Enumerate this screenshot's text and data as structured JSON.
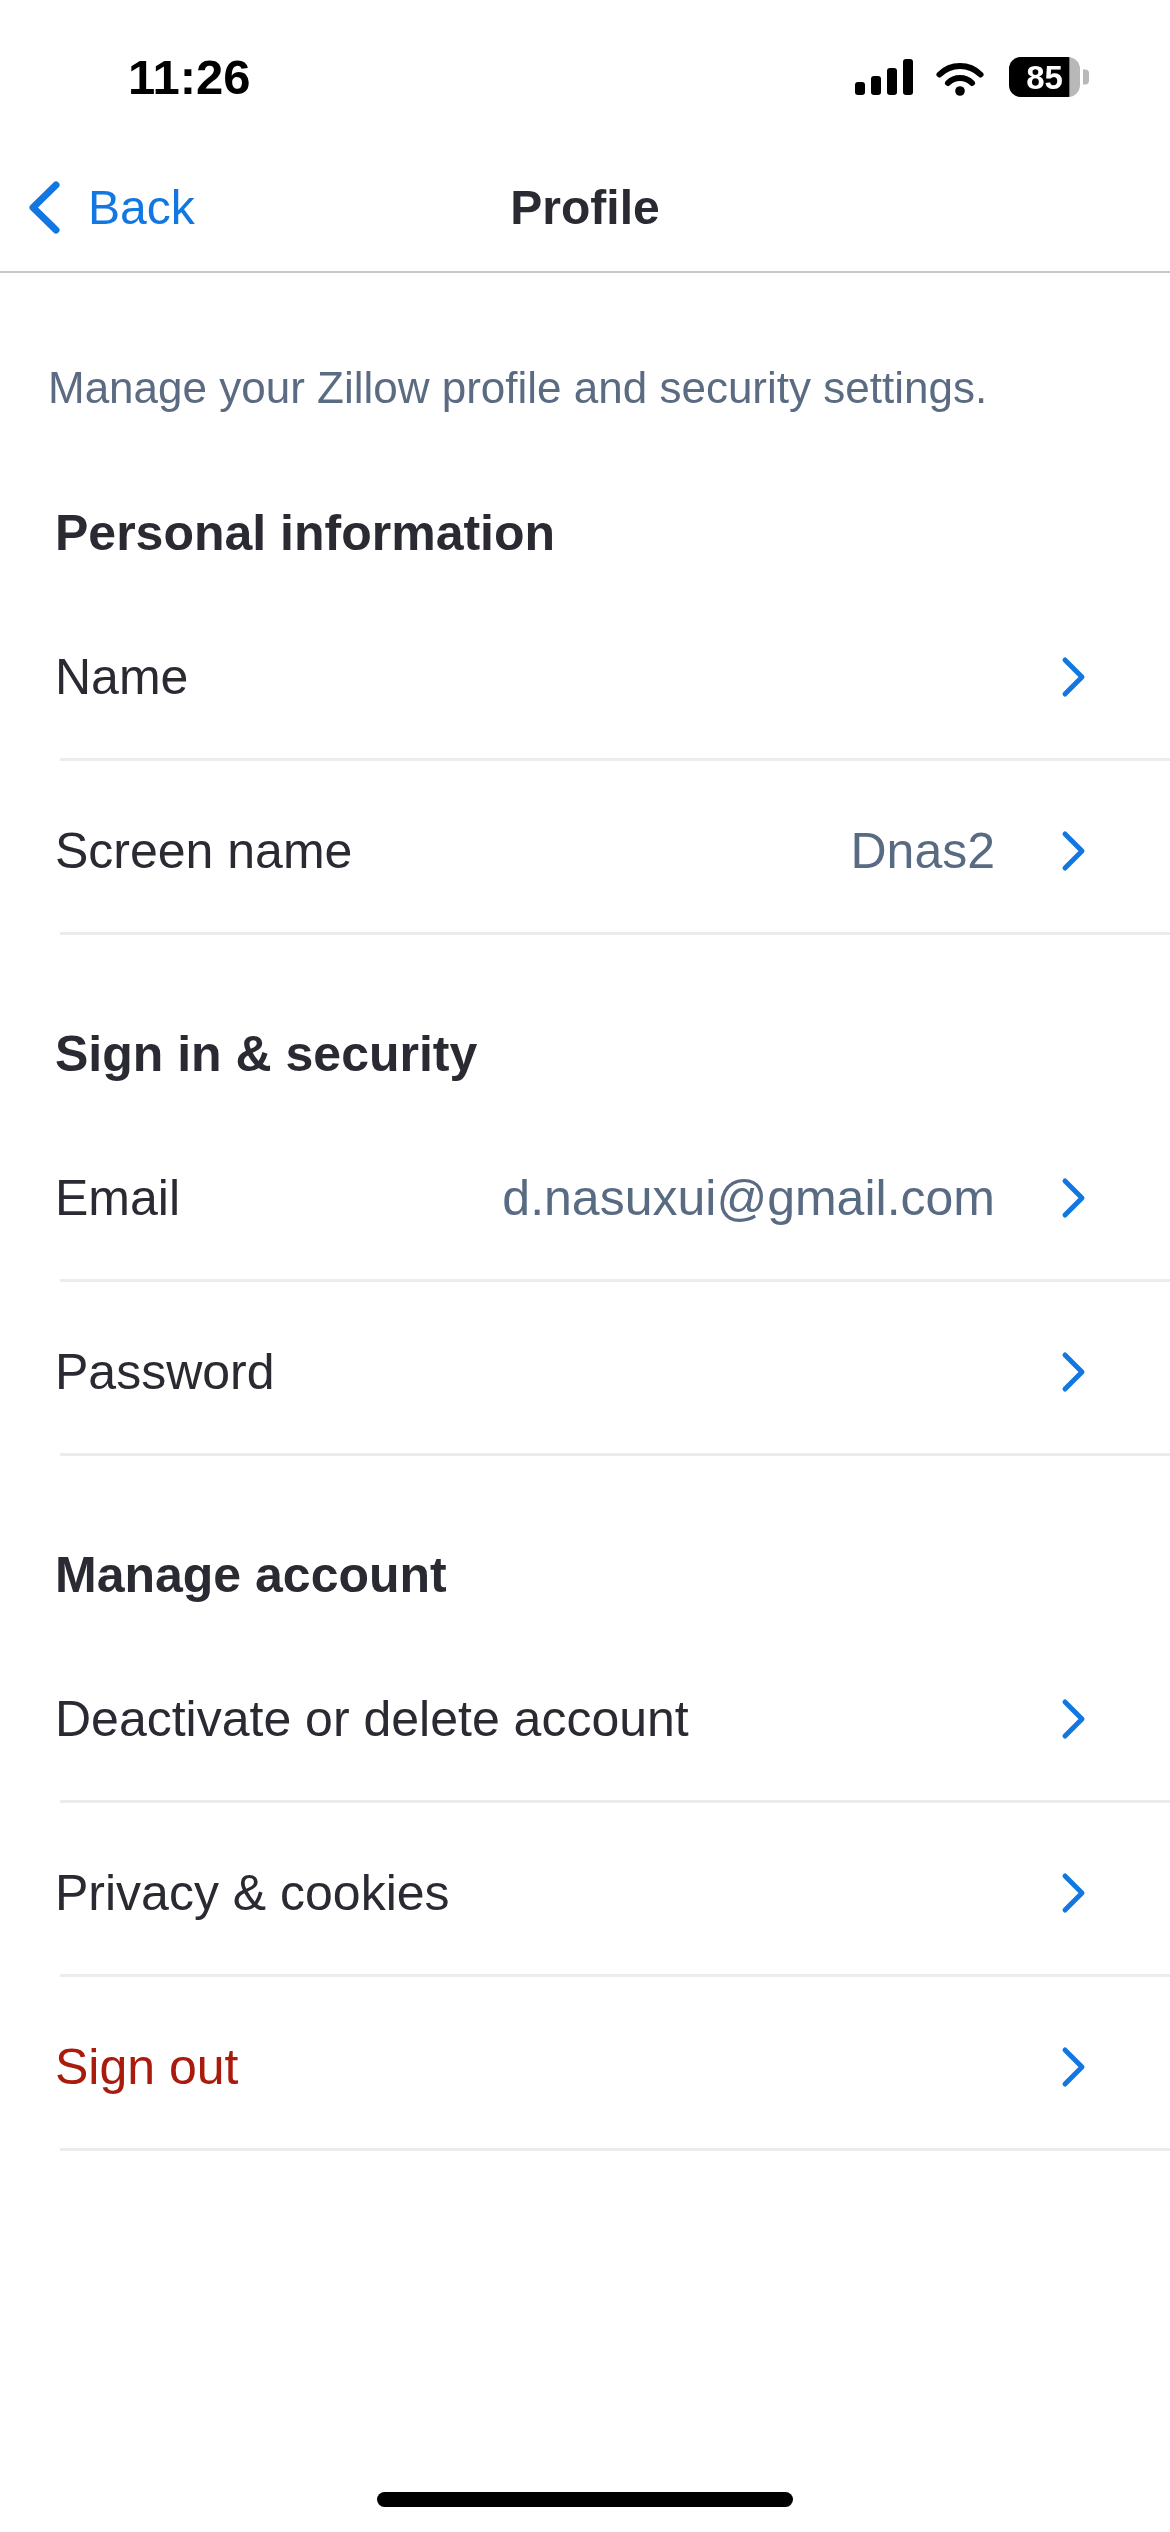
{
  "status_bar": {
    "time": "11:26",
    "battery": "85"
  },
  "nav": {
    "back": "Back",
    "title": "Profile"
  },
  "description": "Manage your Zillow profile and security settings.",
  "sections": [
    {
      "heading": "Personal information",
      "items": [
        {
          "label": "Name",
          "kind": "default"
        },
        {
          "label": "Screen name",
          "value": "Dnas2",
          "kind": "default"
        }
      ]
    },
    {
      "heading": "Sign in & security",
      "items": [
        {
          "label": "Email",
          "value": "d.nasuxui@gmail.com",
          "kind": "default"
        },
        {
          "label": "Password",
          "kind": "default"
        }
      ]
    },
    {
      "heading": "Manage account",
      "items": [
        {
          "label": "Deactivate or delete account",
          "kind": "default"
        },
        {
          "label": "Privacy & cookies",
          "kind": "default"
        },
        {
          "label": "Sign out",
          "kind": "destructive"
        }
      ]
    }
  ]
}
